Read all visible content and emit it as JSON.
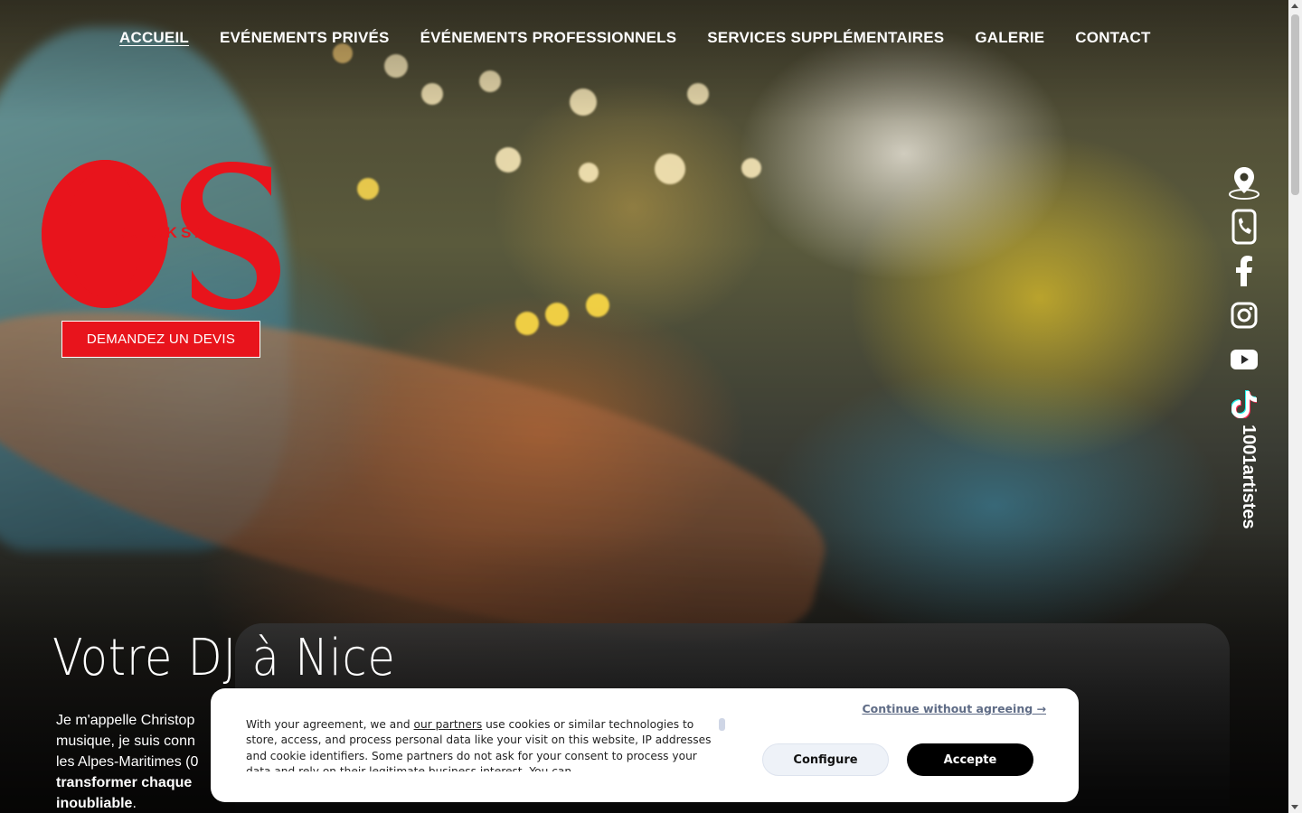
{
  "nav": {
    "items": [
      {
        "label": "ACCUEIL",
        "active": true
      },
      {
        "label": "EVÉNEMENTS PRIVÉS"
      },
      {
        "label": "ÉVÉNEMENTS PROFESSIONNELS"
      },
      {
        "label": "SERVICES SUPPLÉMENTAIRES"
      },
      {
        "label": "GALERIE"
      },
      {
        "label": "CONTACT"
      }
    ]
  },
  "logo": {
    "monogram": "OS",
    "text": "DJ OKSA",
    "color": "#e8141c"
  },
  "cta": {
    "label": "DEMANDEZ UN DEVIS"
  },
  "social": {
    "icons": [
      "map-pin-icon",
      "phone-icon",
      "facebook-icon",
      "instagram-icon",
      "youtube-icon",
      "tiktok-icon"
    ],
    "partner_label": "1001artistes"
  },
  "hero": {
    "title": "Votre DJ à Nice",
    "intro_line1": "Je m'appelle Christop",
    "intro_line2": "musique, je suis conn",
    "intro_line3": "les Alpes-Maritimes (0",
    "intro_bold1": "transformer chaque",
    "intro_bold2": "inoubliable",
    "intro_end": "."
  },
  "cookie": {
    "text_before": "With your agreement, we and ",
    "link": "our partners",
    "text_after": " use cookies or similar technologies to store, access, and process personal data like your visit on this website, IP addresses and cookie identifiers. Some partners do not ask for your consent to process your data and rely on their legitimate business interest. You can",
    "continue": "Continue without agreeing →",
    "configure": "Configure",
    "accept": "Accepte"
  }
}
